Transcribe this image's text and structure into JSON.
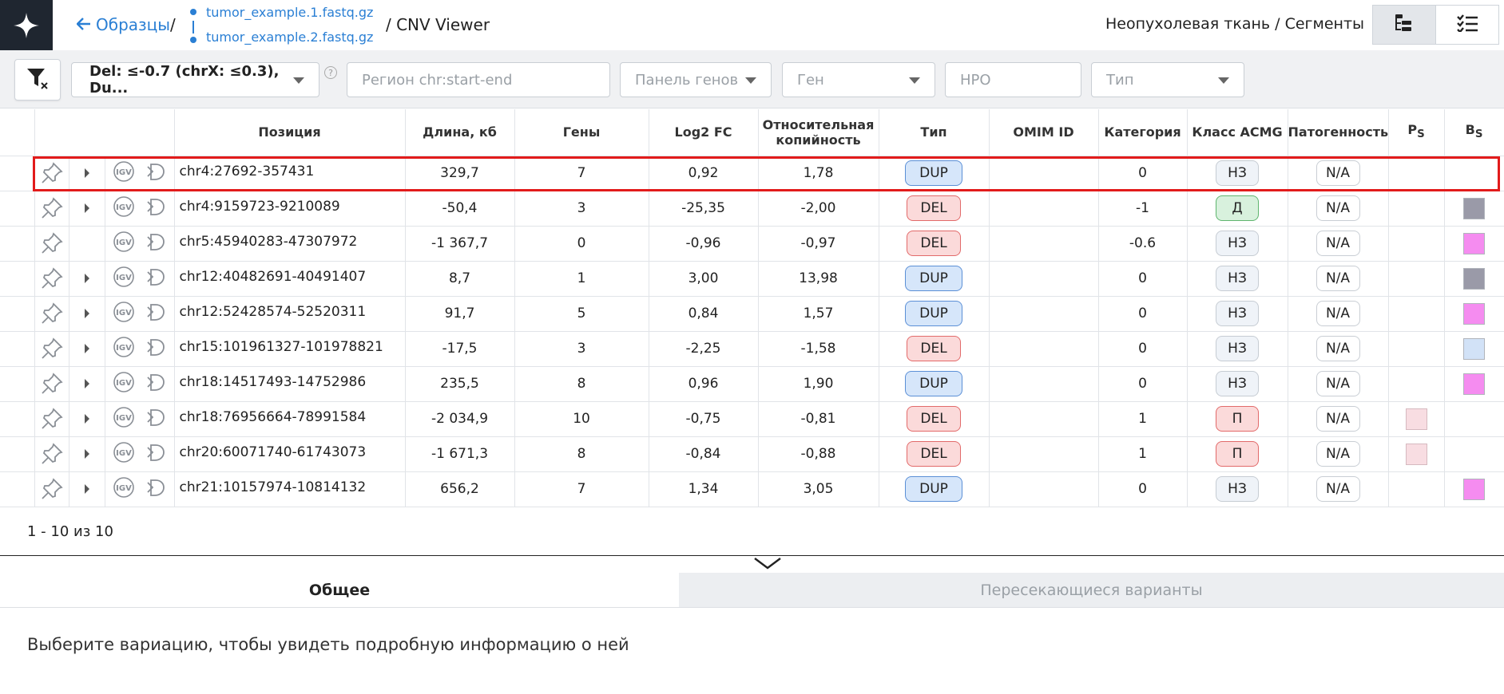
{
  "header": {
    "back_label": "Образцы",
    "slash1": "/",
    "file1": "tumor_example.1.fastq.gz",
    "file2": "tumor_example.2.fastq.gz",
    "page_title": "/ CNV Viewer",
    "view_title": "Неопухолевая ткань / Сегменты"
  },
  "filters": {
    "deletion_filter": "Del: ≤-0.7 (chrX: ≤0.3), Du...",
    "region_placeholder": "Регион chr:start-end",
    "gene_panel_placeholder": "Панель генов",
    "gene_placeholder": "Ген",
    "hpo_placeholder": "HPO",
    "type_placeholder": "Тип",
    "help_glyph": "?"
  },
  "table": {
    "columns": {
      "position": "Позиция",
      "length": "Длина, кб",
      "genes": "Гены",
      "log2fc": "Log2 FC",
      "copy_1": "Относительная",
      "copy_2": "копийность",
      "type": "Тип",
      "omim": "OMIM ID",
      "category": "Категория",
      "acmg": "Класс ACMG",
      "pathogenicity": "Патогенность",
      "ps": "P",
      "ps_sub": "S",
      "bs": "B",
      "bs_sub": "S"
    },
    "rows": [
      {
        "position": "chr4:27692-357431",
        "length": "329,7",
        "genes": "7",
        "log2fc": "0,92",
        "copy": "1,78",
        "type": "DUP",
        "omim": "",
        "category": "0",
        "acmg": "НЗ",
        "pathogenicity": "N/A",
        "ps": "",
        "bs": "",
        "expand": true
      },
      {
        "position": "chr4:9159723-9210089",
        "length": "-50,4",
        "genes": "3",
        "log2fc": "-25,35",
        "copy": "-2,00",
        "type": "DEL",
        "omim": "",
        "category": "-1",
        "acmg": "Д",
        "pathogenicity": "N/A",
        "ps": "",
        "bs": "#9a9aa8",
        "expand": true
      },
      {
        "position": "chr5:45940283-47307972",
        "length": "-1 367,7",
        "genes": "0",
        "log2fc": "-0,96",
        "copy": "-0,97",
        "type": "DEL",
        "omim": "",
        "category": "-0.6",
        "acmg": "НЗ",
        "pathogenicity": "N/A",
        "ps": "",
        "bs": "#f58cf0",
        "expand": false
      },
      {
        "position": "chr12:40482691-40491407",
        "length": "8,7",
        "genes": "1",
        "log2fc": "3,00",
        "copy": "13,98",
        "type": "DUP",
        "omim": "",
        "category": "0",
        "acmg": "НЗ",
        "pathogenicity": "N/A",
        "ps": "",
        "bs": "#9a9aa8",
        "expand": true
      },
      {
        "position": "chr12:52428574-52520311",
        "length": "91,7",
        "genes": "5",
        "log2fc": "0,84",
        "copy": "1,57",
        "type": "DUP",
        "omim": "",
        "category": "0",
        "acmg": "НЗ",
        "pathogenicity": "N/A",
        "ps": "",
        "bs": "#f58cf0",
        "expand": true
      },
      {
        "position": "chr15:101961327-101978821",
        "length": "-17,5",
        "genes": "3",
        "log2fc": "-2,25",
        "copy": "-1,58",
        "type": "DEL",
        "omim": "",
        "category": "0",
        "acmg": "НЗ",
        "pathogenicity": "N/A",
        "ps": "",
        "bs": "#d2e2f7",
        "expand": true
      },
      {
        "position": "chr18:14517493-14752986",
        "length": "235,5",
        "genes": "8",
        "log2fc": "0,96",
        "copy": "1,90",
        "type": "DUP",
        "omim": "",
        "category": "0",
        "acmg": "НЗ",
        "pathogenicity": "N/A",
        "ps": "",
        "bs": "#f58cf0",
        "expand": true
      },
      {
        "position": "chr18:76956664-78991584",
        "length": "-2 034,9",
        "genes": "10",
        "log2fc": "-0,75",
        "copy": "-0,81",
        "type": "DEL",
        "omim": "",
        "category": "1",
        "acmg": "П",
        "pathogenicity": "N/A",
        "ps": "#f8dde2",
        "bs": "",
        "expand": true
      },
      {
        "position": "chr20:60071740-61743073",
        "length": "-1 671,3",
        "genes": "8",
        "log2fc": "-0,84",
        "copy": "-0,88",
        "type": "DEL",
        "omim": "",
        "category": "1",
        "acmg": "П",
        "pathogenicity": "N/A",
        "ps": "#f8dde2",
        "bs": "",
        "expand": true
      },
      {
        "position": "chr21:10157974-10814132",
        "length": "656,2",
        "genes": "7",
        "log2fc": "1,34",
        "copy": "3,05",
        "type": "DUP",
        "omim": "",
        "category": "0",
        "acmg": "НЗ",
        "pathogenicity": "N/A",
        "ps": "",
        "bs": "#f58cf0",
        "expand": true
      }
    ],
    "highlighted_row": 0
  },
  "pager": {
    "text": "1 - 10 из 10"
  },
  "tabs": {
    "general": "Общее",
    "overlapping": "Пересекающиеся варианты"
  },
  "details": {
    "empty_message": "Выберите вариацию, чтобы увидеть подробную информацию о ней"
  },
  "icons": {
    "logo": "sparkle-logo-icon",
    "back": "arrow-left-icon",
    "filter": "filter-clear-icon",
    "pin": "pin-icon",
    "expand": "caret-right-icon",
    "igv": "igv-icon",
    "decipher": "decipher-icon",
    "tree_view": "tree-view-icon",
    "list_view": "list-view-icon",
    "collapse": "chevron-down-icon"
  },
  "colors": {
    "link": "#2a7fd4",
    "dup_bg": "#d6e6fa",
    "del_bg": "#fbdada",
    "highlight": "#e21b1b",
    "logo_bg": "#1f2630"
  }
}
